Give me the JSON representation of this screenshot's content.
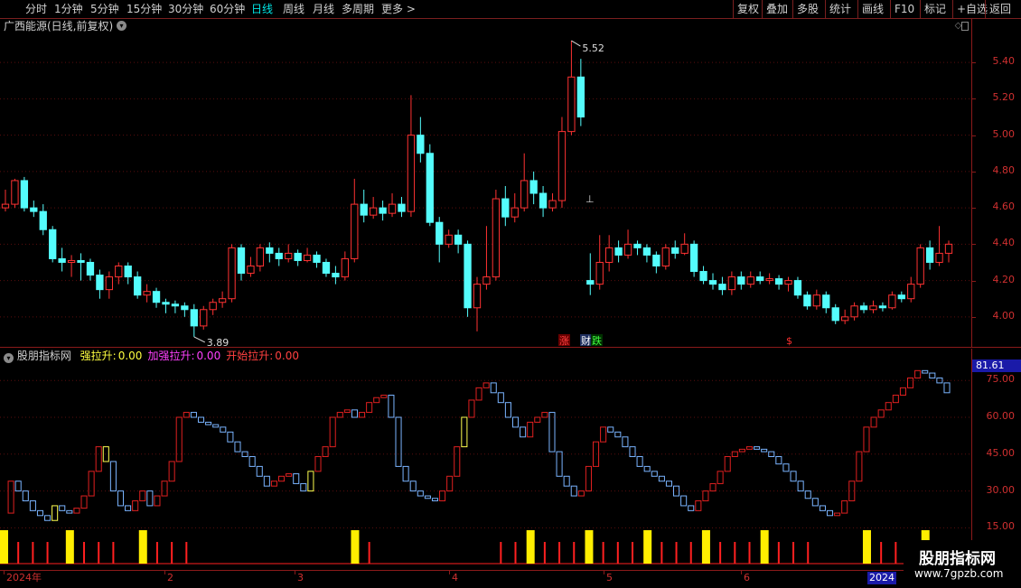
{
  "toolbar": {
    "left": [
      "分时",
      "1分钟",
      "5分钟",
      "15分钟",
      "30分钟",
      "60分钟",
      "日线",
      "周线",
      "月线",
      "多周期",
      "更多 >"
    ],
    "active_index": 6,
    "right": [
      "复权",
      "叠加",
      "多股",
      "统计",
      "画线",
      "F10",
      "标记",
      "+自选",
      "返回"
    ]
  },
  "main_chart": {
    "title": "广西能源(日线,前复权)",
    "y_ticks": [
      "5.40",
      "5.20",
      "5.00",
      "4.80",
      "4.60",
      "4.40",
      "4.20",
      "4.00"
    ],
    "high_label": "5.52",
    "low_label": "3.89",
    "markers": [
      {
        "text": "涨",
        "color": "#ff4040",
        "bg": "#6a0000"
      },
      {
        "text": "财",
        "color": "#ffffff",
        "bg": "#203060"
      },
      {
        "text": "跌",
        "color": "#40ff40",
        "bg": "#003000"
      },
      {
        "text": "$",
        "color": "#ff3030",
        "bg": "#000000"
      }
    ]
  },
  "indicator": {
    "name": "股朋指标网",
    "fields": [
      {
        "label": "强拉升:",
        "value": "0.00",
        "color": "#ffff40"
      },
      {
        "label": "加强拉升:",
        "value": "0.00",
        "color": "#ff40ff"
      },
      {
        "label": "开始拉升:",
        "value": "0.00",
        "color": "#ff4040"
      }
    ],
    "y_ticks": [
      "75.00",
      "60.00",
      "45.00",
      "30.00",
      "15.00"
    ],
    "current_value": "81.61"
  },
  "date_axis": {
    "labels": [
      "2024年",
      "2",
      "3",
      "4",
      "5",
      "6"
    ],
    "end_badge": "2024"
  },
  "watermark": {
    "title": "股朋指标网",
    "url": "www.7gpzb.com"
  },
  "chart_data": {
    "type": "candlestick",
    "title": "广西能源(日线,前复权)",
    "ylim": [
      3.85,
      5.55
    ],
    "high": 5.52,
    "low": 3.89,
    "candles": [
      [
        4.6,
        4.62,
        4.7,
        4.58
      ],
      [
        4.62,
        4.75,
        4.76,
        4.6
      ],
      [
        4.75,
        4.6,
        4.77,
        4.58
      ],
      [
        4.6,
        4.58,
        4.64,
        4.55
      ],
      [
        4.58,
        4.48,
        4.62,
        4.45
      ],
      [
        4.48,
        4.32,
        4.5,
        4.3
      ],
      [
        4.32,
        4.3,
        4.38,
        4.25
      ],
      [
        4.3,
        4.31,
        4.34,
        4.22
      ],
      [
        4.31,
        4.3,
        4.35,
        4.2
      ],
      [
        4.3,
        4.23,
        4.32,
        4.2
      ],
      [
        4.23,
        4.15,
        4.26,
        4.1
      ],
      [
        4.15,
        4.22,
        4.25,
        4.1
      ],
      [
        4.22,
        4.28,
        4.3,
        4.18
      ],
      [
        4.28,
        4.22,
        4.3,
        4.18
      ],
      [
        4.22,
        4.12,
        4.25,
        4.1
      ],
      [
        4.12,
        4.14,
        4.18,
        4.08
      ],
      [
        4.14,
        4.08,
        4.16,
        4.05
      ],
      [
        4.08,
        4.07,
        4.1,
        4.02
      ],
      [
        4.07,
        4.06,
        4.09,
        4.02
      ],
      [
        4.06,
        4.04,
        4.08,
        4.0
      ],
      [
        4.04,
        3.95,
        4.07,
        3.89
      ],
      [
        3.95,
        4.04,
        4.06,
        3.93
      ],
      [
        4.04,
        4.08,
        4.1,
        4.01
      ],
      [
        4.08,
        4.1,
        4.14,
        4.05
      ],
      [
        4.1,
        4.38,
        4.4,
        4.08
      ],
      [
        4.38,
        4.24,
        4.4,
        4.2
      ],
      [
        4.24,
        4.28,
        4.33,
        4.22
      ],
      [
        4.28,
        4.38,
        4.4,
        4.25
      ],
      [
        4.38,
        4.35,
        4.41,
        4.3
      ],
      [
        4.35,
        4.32,
        4.38,
        4.28
      ],
      [
        4.32,
        4.35,
        4.4,
        4.3
      ],
      [
        4.35,
        4.31,
        4.37,
        4.28
      ],
      [
        4.31,
        4.34,
        4.38,
        4.3
      ],
      [
        4.34,
        4.3,
        4.36,
        4.27
      ],
      [
        4.3,
        4.24,
        4.32,
        4.22
      ],
      [
        4.24,
        4.22,
        4.28,
        4.18
      ],
      [
        4.22,
        4.32,
        4.36,
        4.2
      ],
      [
        4.32,
        4.62,
        4.76,
        4.3
      ],
      [
        4.62,
        4.56,
        4.7,
        4.52
      ],
      [
        4.56,
        4.6,
        4.66,
        4.54
      ],
      [
        4.6,
        4.57,
        4.64,
        4.53
      ],
      [
        4.57,
        4.62,
        4.68,
        4.55
      ],
      [
        4.62,
        4.58,
        4.66,
        4.55
      ],
      [
        4.58,
        5.0,
        5.22,
        4.55
      ],
      [
        5.0,
        4.9,
        5.1,
        4.85
      ],
      [
        4.9,
        4.52,
        4.95,
        4.5
      ],
      [
        4.52,
        4.4,
        4.55,
        4.3
      ],
      [
        4.4,
        4.45,
        4.48,
        4.38
      ],
      [
        4.45,
        4.4,
        4.48,
        4.35
      ],
      [
        4.4,
        4.05,
        4.42,
        4.0
      ],
      [
        4.05,
        4.18,
        4.22,
        3.92
      ],
      [
        4.18,
        4.22,
        4.5,
        4.15
      ],
      [
        4.22,
        4.65,
        4.7,
        4.2
      ],
      [
        4.65,
        4.55,
        4.72,
        4.5
      ],
      [
        4.55,
        4.6,
        4.68,
        4.52
      ],
      [
        4.6,
        4.75,
        4.9,
        4.58
      ],
      [
        4.75,
        4.68,
        4.8,
        4.62
      ],
      [
        4.68,
        4.6,
        4.72,
        4.55
      ],
      [
        4.6,
        4.64,
        4.68,
        4.58
      ],
      [
        4.64,
        5.02,
        5.1,
        4.6
      ],
      [
        5.02,
        5.32,
        5.52,
        5.0
      ],
      [
        5.32,
        5.1,
        5.42,
        5.05
      ],
      [
        4.2,
        4.18,
        4.35,
        4.12
      ],
      [
        4.18,
        4.3,
        4.45,
        4.15
      ],
      [
        4.3,
        4.38,
        4.45,
        4.25
      ],
      [
        4.38,
        4.34,
        4.42,
        4.3
      ],
      [
        4.34,
        4.4,
        4.48,
        4.32
      ],
      [
        4.4,
        4.38,
        4.42,
        4.34
      ],
      [
        4.38,
        4.34,
        4.4,
        4.3
      ],
      [
        4.34,
        4.28,
        4.36,
        4.24
      ],
      [
        4.28,
        4.38,
        4.4,
        4.26
      ],
      [
        4.38,
        4.35,
        4.42,
        4.32
      ],
      [
        4.35,
        4.4,
        4.46,
        4.34
      ],
      [
        4.4,
        4.25,
        4.42,
        4.22
      ],
      [
        4.25,
        4.2,
        4.28,
        4.18
      ],
      [
        4.2,
        4.18,
        4.24,
        4.15
      ],
      [
        4.18,
        4.15,
        4.22,
        4.12
      ],
      [
        4.15,
        4.22,
        4.25,
        4.12
      ],
      [
        4.22,
        4.18,
        4.25,
        4.15
      ],
      [
        4.18,
        4.22,
        4.25,
        4.16
      ],
      [
        4.22,
        4.2,
        4.25,
        4.18
      ],
      [
        4.2,
        4.21,
        4.24,
        4.18
      ],
      [
        4.21,
        4.18,
        4.23,
        4.15
      ],
      [
        4.18,
        4.2,
        4.22,
        4.14
      ],
      [
        4.2,
        4.12,
        4.22,
        4.1
      ],
      [
        4.12,
        4.06,
        4.14,
        4.04
      ],
      [
        4.06,
        4.12,
        4.15,
        4.04
      ],
      [
        4.12,
        4.05,
        4.14,
        4.02
      ],
      [
        4.05,
        3.98,
        4.07,
        3.96
      ],
      [
        3.98,
        4.0,
        4.04,
        3.96
      ],
      [
        4.0,
        4.06,
        4.08,
        3.98
      ],
      [
        4.06,
        4.04,
        4.08,
        4.02
      ],
      [
        4.04,
        4.06,
        4.09,
        4.02
      ],
      [
        4.06,
        4.05,
        4.08,
        4.03
      ],
      [
        4.05,
        4.12,
        4.14,
        4.04
      ],
      [
        4.12,
        4.1,
        4.14,
        4.08
      ],
      [
        4.1,
        4.18,
        4.22,
        4.08
      ],
      [
        4.18,
        4.38,
        4.4,
        4.16
      ],
      [
        4.38,
        4.3,
        4.42,
        4.26
      ],
      [
        4.3,
        4.35,
        4.5,
        4.28
      ],
      [
        4.35,
        4.4,
        4.42,
        4.3
      ]
    ],
    "indicator": {
      "title": "股朋指标网",
      "ylim": [
        10,
        85
      ],
      "values": [
        21,
        34,
        30,
        26,
        22,
        20,
        18,
        24,
        22,
        21,
        23,
        28,
        38,
        48,
        42,
        30,
        24,
        22,
        26,
        30,
        24,
        28,
        34,
        42,
        60,
        62,
        60,
        58,
        57,
        56,
        54,
        50,
        46,
        44,
        40,
        36,
        32,
        34,
        36,
        37,
        33,
        30,
        38,
        44,
        48,
        60,
        62,
        63,
        60,
        62,
        66,
        68,
        69,
        60,
        40,
        34,
        30,
        28,
        27,
        26,
        30,
        36,
        48,
        60,
        67,
        72,
        74,
        70,
        66,
        60,
        56,
        52,
        58,
        60,
        62,
        46,
        36,
        32,
        28,
        30,
        40,
        50,
        56,
        54,
        52,
        48,
        44,
        40,
        38,
        36,
        34,
        32,
        28,
        24,
        22,
        26,
        30,
        33,
        38,
        44,
        46,
        47,
        48,
        47,
        46,
        44,
        41,
        38,
        34,
        30,
        27,
        24,
        22,
        20,
        21,
        26,
        34,
        46,
        56,
        60,
        63,
        66,
        69,
        72,
        76,
        79,
        78,
        76,
        74,
        70
      ],
      "spikes": [
        0,
        2,
        4,
        6,
        9,
        11,
        13,
        15,
        19,
        21,
        23,
        25,
        48,
        50,
        68,
        70,
        72,
        74,
        76,
        78,
        80,
        82,
        84,
        86,
        88,
        90,
        92,
        94,
        96,
        98,
        100,
        102,
        104,
        106,
        108,
        110,
        118,
        120,
        122,
        124,
        126
      ]
    }
  }
}
